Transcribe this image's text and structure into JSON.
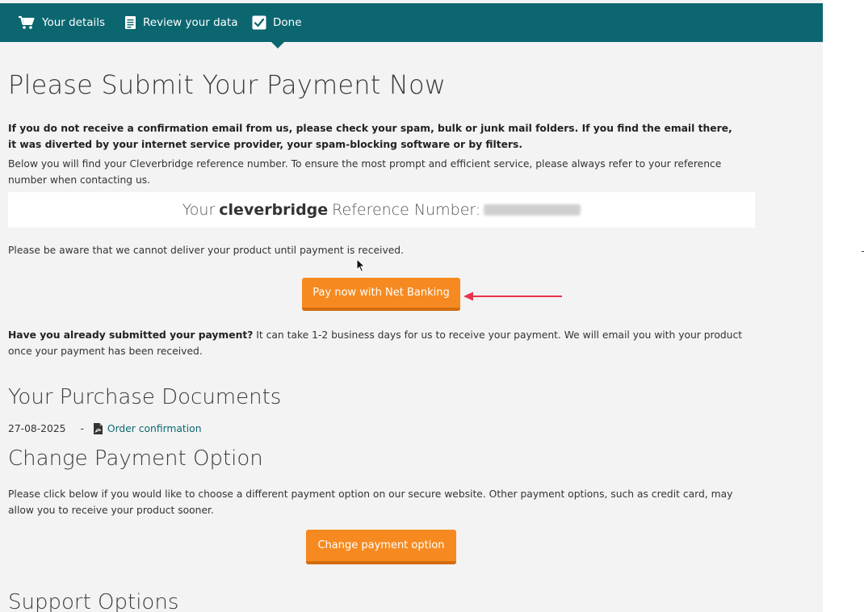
{
  "steps": [
    {
      "label": "Your details",
      "icon": "cart-icon"
    },
    {
      "label": "Review your data",
      "icon": "document-icon"
    },
    {
      "label": "Done",
      "icon": "checkbox-icon"
    }
  ],
  "page_title": "Please Submit Your Payment Now",
  "notice_bold": "If you do not receive a confirmation email from us, please check your spam, bulk or junk mail folders. If you find the email there, it was diverted by your internet service provider, your spam-blocking software or by filters.",
  "reference_info": "Below you will find your Cleverbridge reference number. To ensure the most prompt and efficient service, please always refer to your reference number when contacting us.",
  "reference": {
    "prefix": "Your",
    "brand": "cleverbridge",
    "suffix": "Reference Number:"
  },
  "delivery_notice": "Please be aware that we cannot deliver your product until payment is received.",
  "pay_button": "Pay now with Net Banking",
  "submitted_bold": "Have you already submitted your payment?",
  "submitted_text": " It can take 1-2 business days for us to receive your payment. We will email you with your product once your payment has been received.",
  "documents": {
    "heading": "Your Purchase Documents",
    "date": "27-08-2025",
    "separator": "-",
    "link": "Order confirmation"
  },
  "change_payment": {
    "heading": "Change Payment Option",
    "text": "Please click below if you would like to choose a different payment option on our secure website. Other payment options, such as credit card, may allow you to receive your product sooner.",
    "button": "Change payment option"
  },
  "support_heading": "Support Options",
  "colors": {
    "header": "#0c6670",
    "button": "#f68a20",
    "link": "#0c6670",
    "annotation_arrow": "#e8334a"
  }
}
